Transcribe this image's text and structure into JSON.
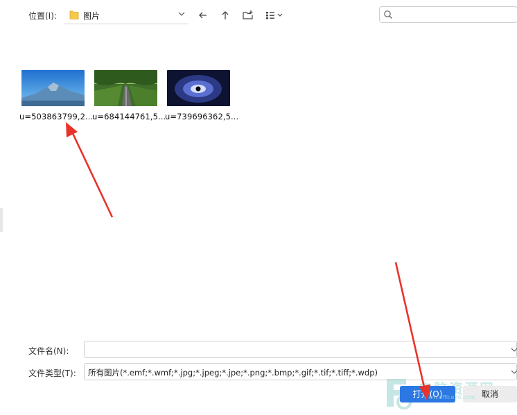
{
  "toolbar": {
    "location_label": "位置(I):",
    "current_folder": "图片"
  },
  "files": [
    {
      "name": "u=503863799,2...",
      "thumb": "mountain"
    },
    {
      "name": "u=684144761,5...",
      "thumb": "tree-road"
    },
    {
      "name": "u=739696362,5...",
      "thumb": "space-eye"
    }
  ],
  "form": {
    "filename_label": "文件名(N):",
    "filename_value": "",
    "filetype_label": "文件类型(T):",
    "filetype_value": "所有图片(*.emf;*.wmf;*.jpg;*.jpeg;*.jpe;*.png;*.bmp;*.gif;*.tif;*.tiff;*.wdp)"
  },
  "buttons": {
    "open": "打开(O)",
    "cancel": "取消"
  },
  "watermark": {
    "text": "电脑资源网",
    "url": "www.office26.com"
  },
  "colors": {
    "accent": "#2b78e4",
    "annotation_arrow": "#e8332a"
  }
}
